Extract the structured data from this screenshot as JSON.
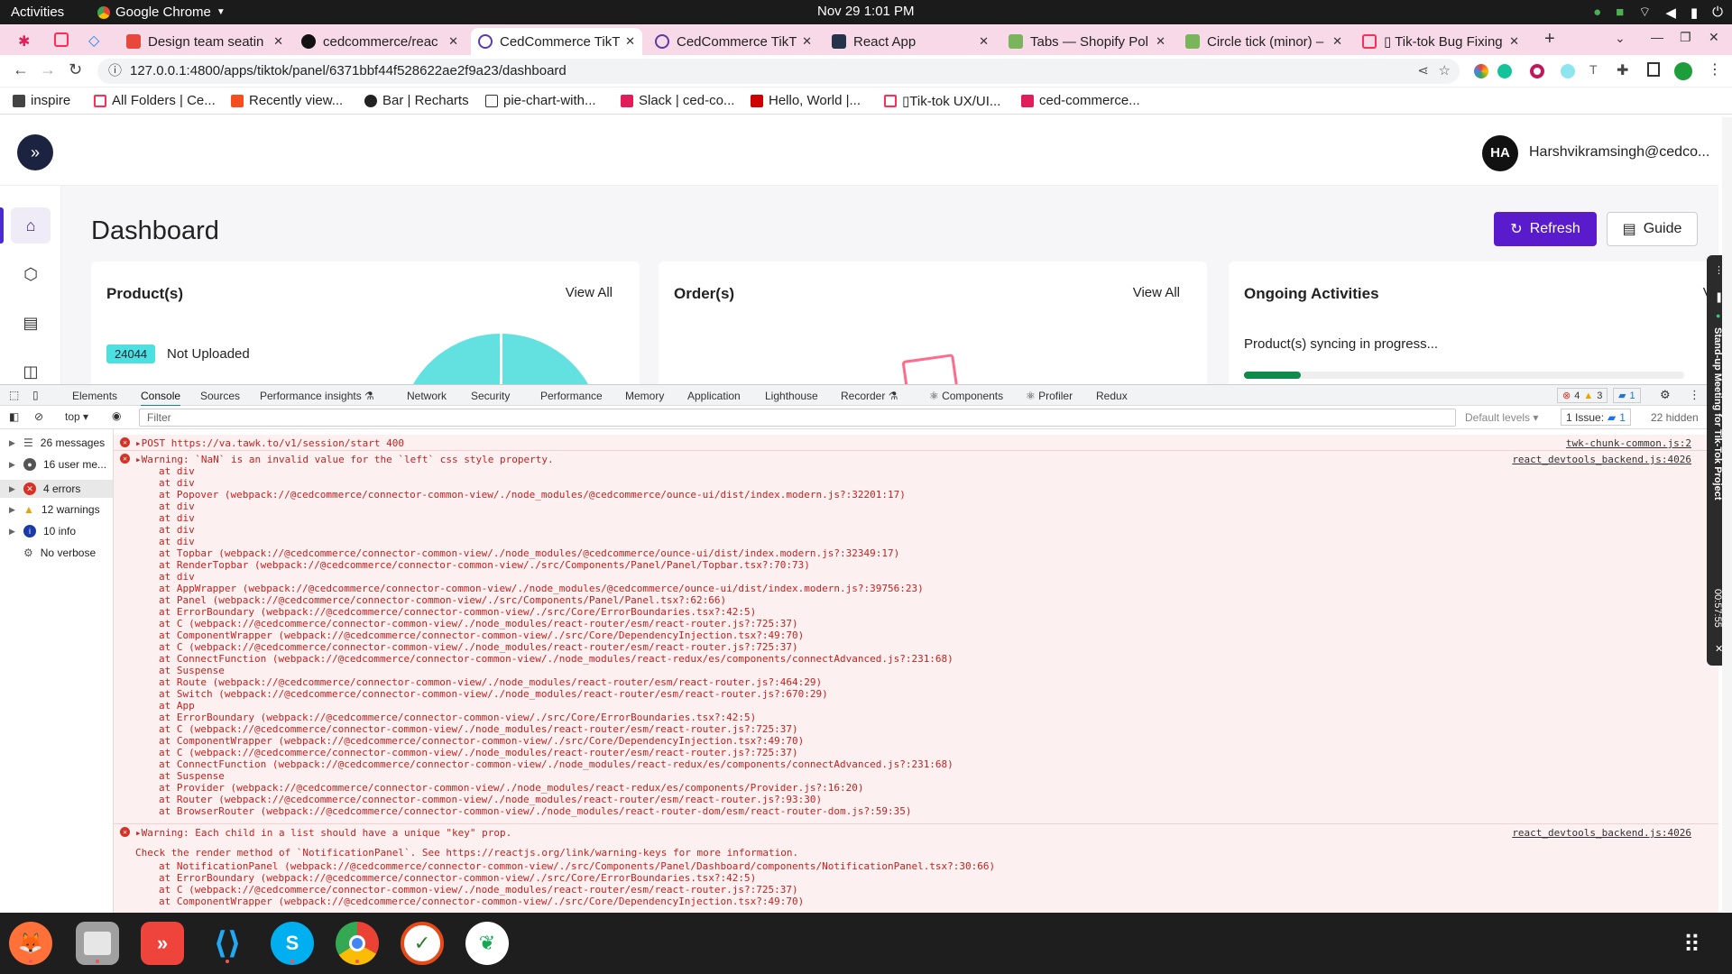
{
  "os": {
    "activities": "Activities",
    "app_name": "Google Chrome",
    "clock": "Nov 29  1:01 PM"
  },
  "tabs": [
    {
      "title": "Design team seatin",
      "icon_color": "#e8473b"
    },
    {
      "title": "cedcommerce/reac",
      "icon_color": "#111111"
    },
    {
      "title": "CedCommerce TikT",
      "icon_color": "#5b3aa8"
    },
    {
      "title": "CedCommerce TikT",
      "icon_color": "#5b3aa8"
    },
    {
      "title": "React App",
      "icon_color": "#24324a"
    },
    {
      "title": "Tabs — Shopify Pol",
      "icon_color": "#7ab55c"
    },
    {
      "title": "Circle tick (minor) –",
      "icon_color": "#7ab55c"
    },
    {
      "title": "▯ Tik-tok Bug Fixing",
      "icon_color": "#ff2d55"
    }
  ],
  "address": {
    "url": "127.0.0.1:4800/apps/tiktok/panel/6371bbf44f528622ae2f9a23/dashboard"
  },
  "bookmarks": [
    {
      "label": "inspire",
      "color": "#555555"
    },
    {
      "label": "All Folders | Ce...",
      "color": "#ff2d55"
    },
    {
      "label": "Recently view...",
      "color": "#f24e1e"
    },
    {
      "label": "Bar | Recharts",
      "color": "#222222"
    },
    {
      "label": "pie-chart-with...",
      "color": "#888888"
    },
    {
      "label": "Slack | ced-co...",
      "color": "#e01e5a"
    },
    {
      "label": "Hello, World |...",
      "color": "#cc0000"
    },
    {
      "label": "▯Tik-tok UX/UI...",
      "color": "#ff2d55"
    },
    {
      "label": "ced-commerce...",
      "color": "#e01e5a"
    }
  ],
  "app": {
    "avatar_initials": "HA",
    "user_email": "Harshvikramsingh@cedco...",
    "page_title": "Dashboard",
    "refresh_label": "Refresh",
    "guide_label": "Guide",
    "cards": {
      "products": {
        "title": "Product(s)",
        "view_all": "View All",
        "count": "24044",
        "status": "Not Uploaded"
      },
      "orders": {
        "title": "Order(s)",
        "view_all": "View All"
      },
      "activities": {
        "title": "Ongoing Activities",
        "view_all": "View All",
        "sync_text": "Product(s) syncing in progress...",
        "progress": 0.13
      }
    },
    "colors": {
      "primary": "#5a1bcc",
      "accent": "#4de0e0",
      "progress": "#0e8a4a"
    }
  },
  "devtools": {
    "tabs": [
      "Elements",
      "Console",
      "Sources",
      "Performance insights ⚗",
      "Network",
      "Security",
      "Performance",
      "Memory",
      "Application",
      "Lighthouse",
      "Recorder ⚗",
      "⚛ Components",
      "⚛ Profiler",
      "Redux"
    ],
    "errors_count": "4",
    "warnings_count": "3",
    "issues_count": "1",
    "context": "top",
    "filter_placeholder": "Filter",
    "levels": "Default levels ▾",
    "issues_label": "1 Issue:",
    "issues_badge": "1",
    "hidden": "22 hidden",
    "sidebar": [
      {
        "label": "26 messages",
        "icon": "list-icon"
      },
      {
        "label": "16 user me...",
        "icon": "user-icon"
      },
      {
        "label": "4 errors",
        "icon": "error-icon"
      },
      {
        "label": "12 warnings",
        "icon": "warning-icon"
      },
      {
        "label": "10 info",
        "icon": "info-icon"
      },
      {
        "label": "No verbose",
        "icon": "verbose-icon"
      }
    ],
    "messages": [
      {
        "text": "▸POST https://va.tawk.to/v1/session/start 400",
        "source": "twk-chunk-common.js:2"
      },
      {
        "text": "▸Warning: `NaN` is an invalid value for the `left` css style property.",
        "source": "react_devtools_backend.js:4026",
        "trace": [
          "at div",
          "at div",
          "at Popover (webpack://@cedcommerce/connector-common-view/./node_modules/@cedcommerce/ounce-ui/dist/index.modern.js?:32201:17)",
          "at div",
          "at div",
          "at div",
          "at div",
          "at Topbar (webpack://@cedcommerce/connector-common-view/./node_modules/@cedcommerce/ounce-ui/dist/index.modern.js?:32349:17)",
          "at RenderTopbar (webpack://@cedcommerce/connector-common-view/./src/Components/Panel/Panel/Topbar.tsx?:70:73)",
          "at div",
          "at AppWrapper (webpack://@cedcommerce/connector-common-view/./node_modules/@cedcommerce/ounce-ui/dist/index.modern.js?:39756:23)",
          "at Panel (webpack://@cedcommerce/connector-common-view/./src/Components/Panel/Panel.tsx?:62:66)",
          "at ErrorBoundary (webpack://@cedcommerce/connector-common-view/./src/Core/ErrorBoundaries.tsx?:42:5)",
          "at C (webpack://@cedcommerce/connector-common-view/./node_modules/react-router/esm/react-router.js?:725:37)",
          "at ComponentWrapper (webpack://@cedcommerce/connector-common-view/./src/Core/DependencyInjection.tsx?:49:70)",
          "at C (webpack://@cedcommerce/connector-common-view/./node_modules/react-router/esm/react-router.js?:725:37)",
          "at ConnectFunction (webpack://@cedcommerce/connector-common-view/./node_modules/react-redux/es/components/connectAdvanced.js?:231:68)",
          "at Suspense",
          "at Route (webpack://@cedcommerce/connector-common-view/./node_modules/react-router/esm/react-router.js?:464:29)",
          "at Switch (webpack://@cedcommerce/connector-common-view/./node_modules/react-router/esm/react-router.js?:670:29)",
          "at App",
          "at ErrorBoundary (webpack://@cedcommerce/connector-common-view/./src/Core/ErrorBoundaries.tsx?:42:5)",
          "at C (webpack://@cedcommerce/connector-common-view/./node_modules/react-router/esm/react-router.js?:725:37)",
          "at ComponentWrapper (webpack://@cedcommerce/connector-common-view/./src/Core/DependencyInjection.tsx?:49:70)",
          "at C (webpack://@cedcommerce/connector-common-view/./node_modules/react-router/esm/react-router.js?:725:37)",
          "at ConnectFunction (webpack://@cedcommerce/connector-common-view/./node_modules/react-redux/es/components/connectAdvanced.js?:231:68)",
          "at Suspense",
          "at Provider (webpack://@cedcommerce/connector-common-view/./node_modules/react-redux/es/components/Provider.js?:16:20)",
          "at Router (webpack://@cedcommerce/connector-common-view/./node_modules/react-router/esm/react-router.js?:93:30)",
          "at BrowserRouter (webpack://@cedcommerce/connector-common-view/./node_modules/react-router-dom/esm/react-router-dom.js?:59:35)"
        ]
      },
      {
        "text": "▸Warning: Each child in a list should have a unique \"key\" prop.",
        "source": "react_devtools_backend.js:4026",
        "detail": "Check the render method of `NotificationPanel`. See https://reactjs.org/link/warning-keys for more information.",
        "trace": [
          "at NotificationPanel (webpack://@cedcommerce/connector-common-view/./src/Components/Panel/Dashboard/components/NotificationPanel.tsx?:30:66)",
          "at ErrorBoundary (webpack://@cedcommerce/connector-common-view/./src/Core/ErrorBoundaries.tsx?:42:5)",
          "at C (webpack://@cedcommerce/connector-common-view/./node_modules/react-router/esm/react-router.js?:725:37)",
          "at ComponentWrapper (webpack://@cedcommerce/connector-common-view/./src/Core/DependencyInjection.tsx?:49:70)"
        ]
      }
    ]
  },
  "side_widget": {
    "title": "Stand-up Meeting for Tik-Tok Project",
    "timer": "00:57:55"
  },
  "dock": [
    {
      "name": "firefox",
      "color": "#e66000"
    },
    {
      "name": "files",
      "color": "#8a8a8a"
    },
    {
      "name": "anydesk",
      "color": "#ef443b"
    },
    {
      "name": "vscode",
      "color": "#0078d4"
    },
    {
      "name": "skype",
      "color": "#00aff0"
    },
    {
      "name": "chrome",
      "color": "#4285f4"
    },
    {
      "name": "tasks",
      "color": "#e64a19"
    },
    {
      "name": "mongodb-compass",
      "color": "#13aa52"
    }
  ]
}
